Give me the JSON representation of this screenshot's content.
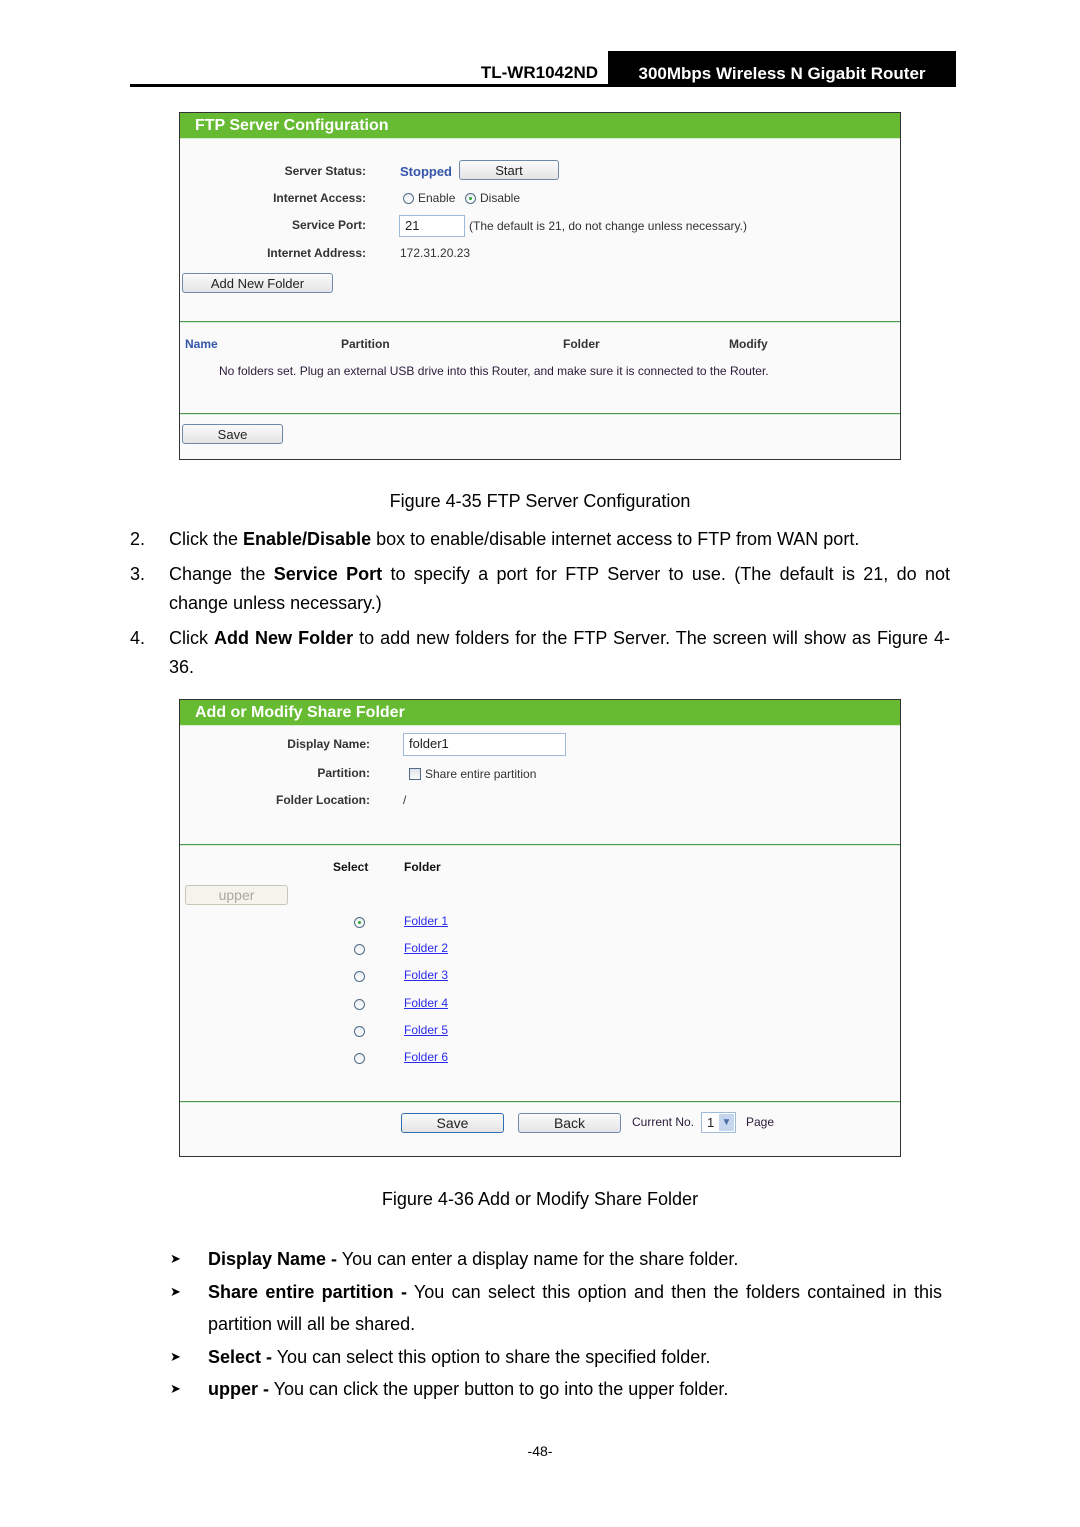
{
  "header": {
    "model": "TL-WR1042ND",
    "product": "300Mbps Wireless N Gigabit Router"
  },
  "ftp_panel": {
    "title": "FTP Server Configuration",
    "server_status_label": "Server Status:",
    "server_status_value": "Stopped",
    "start_button": "Start",
    "internet_access_label": "Internet Access:",
    "internet_access_options": [
      {
        "label": "Enable",
        "checked": false
      },
      {
        "label": "Disable",
        "checked": true
      }
    ],
    "service_port_label": "Service Port:",
    "service_port_value": "21",
    "service_port_hint": "(The default is 21, do not change unless necessary.)",
    "internet_address_label": "Internet Address:",
    "internet_address_value": "172.31.20.23",
    "add_folder_button": "Add New Folder",
    "table_headers": [
      "Name",
      "Partition",
      "Folder",
      "Modify"
    ],
    "empty_message": "No folders set. Plug an external USB drive into this Router, and make sure it is connected to the Router.",
    "save_button": "Save"
  },
  "caption_1": "Figure 4-35 FTP Server Configuration",
  "steps": [
    {
      "num": "2.",
      "pre": "Click the ",
      "bold": "Enable/Disable",
      "post": " box to enable/disable internet access to FTP from WAN port."
    },
    {
      "num": "3.",
      "pre": "Change the ",
      "bold": "Service Port",
      "post": " to specify a port for FTP Server to use. (The default is 21, do not change unless necessary.)"
    },
    {
      "num": "4.",
      "pre": "Click ",
      "bold": "Add New Folder",
      "post": " to add new folders for the FTP Server. The screen will show as Figure 4-36."
    }
  ],
  "share_panel": {
    "title": "Add or Modify Share Folder",
    "display_name_label": "Display Name:",
    "display_name_value": "folder1",
    "partition_label": "Partition:",
    "share_entire_label": "Share entire partition",
    "share_entire_checked": false,
    "folder_location_label": "Folder Location:",
    "folder_location_value": "/",
    "select_header": "Select",
    "folder_header": "Folder",
    "upper_button": "upper",
    "folders": [
      {
        "name": "Folder 1",
        "selected": true
      },
      {
        "name": "Folder 2",
        "selected": false
      },
      {
        "name": "Folder 3",
        "selected": false
      },
      {
        "name": "Folder 4",
        "selected": false
      },
      {
        "name": "Folder 5",
        "selected": false
      },
      {
        "name": "Folder 6",
        "selected": false
      }
    ],
    "save_button": "Save",
    "back_button": "Back",
    "current_no_label": "Current No.",
    "current_no_value": "1",
    "page_label": "Page"
  },
  "caption_2": "Figure 4-36 Add or Modify Share Folder",
  "bullets": [
    {
      "bold": "Display Name -",
      "text": " You can enter a display name for the share folder."
    },
    {
      "bold": "Share entire partition -",
      "text": " You can select this option and then the folders contained in this partition will all be shared."
    },
    {
      "bold": "Select -",
      "text": " You can select this option to share the specified folder."
    },
    {
      "bold": "upper -",
      "text": " You can click the upper button to go into the upper folder."
    }
  ],
  "bullet_icon": "arrowhead-bullet-icon",
  "page_number": "-48-",
  "colors": {
    "panel_title_bg": "#66bb33",
    "separator": "#4a9a4a",
    "link": "#2a2aee",
    "status_text": "#3355aa"
  }
}
